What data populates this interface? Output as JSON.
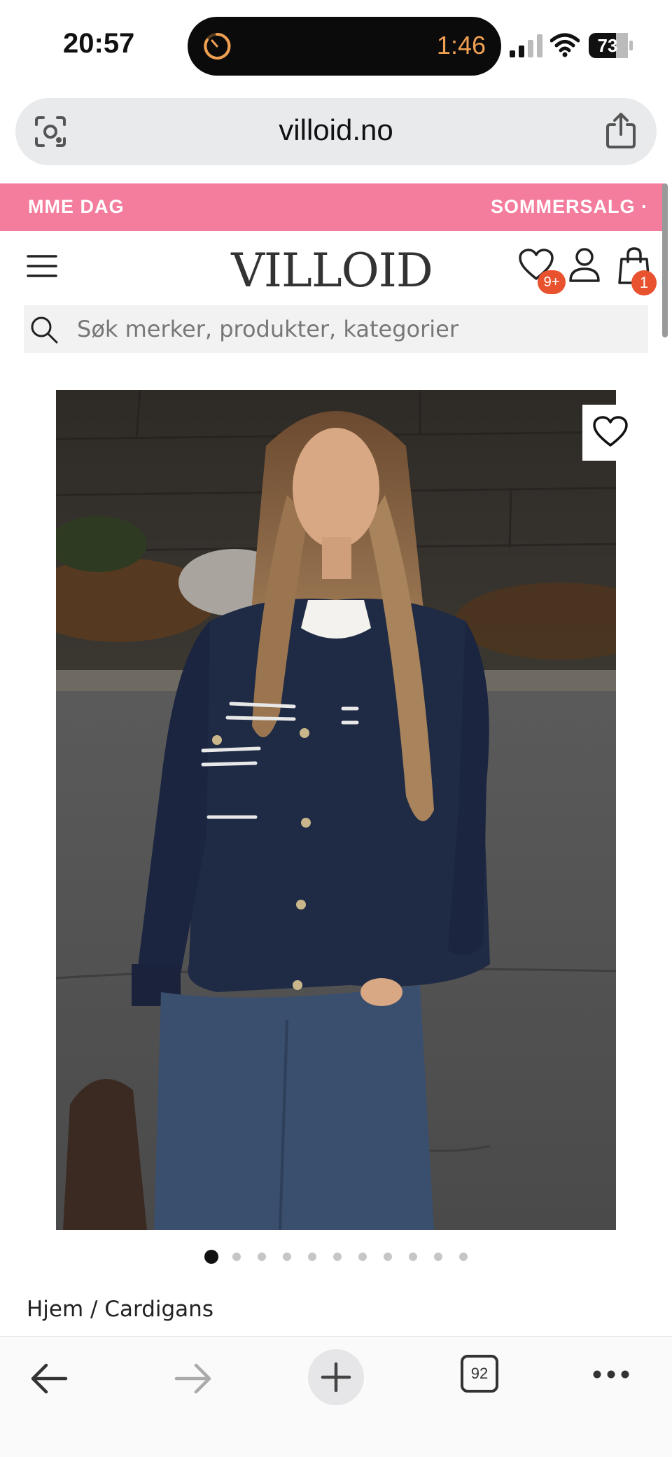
{
  "status_bar": {
    "time": "20:57",
    "timer": "1:46",
    "battery": "73"
  },
  "browser": {
    "url": "villoid.no",
    "tab_count": "92"
  },
  "promo": {
    "left_text": "MME DAG",
    "right_text": "SOMMERSALG ·"
  },
  "header": {
    "logo": "VILLOID",
    "wishlist_badge": "9+",
    "cart_badge": "1"
  },
  "search": {
    "placeholder": "Søk merker, produkter, kategorier"
  },
  "carousel": {
    "total_images": 11,
    "active_index": 0
  },
  "breadcrumb": {
    "home": "Hjem",
    "separator": " / ",
    "category": "Cardigans"
  },
  "colors": {
    "promo_bg": "#f47c9c",
    "badge": "#e8522e",
    "cardigan": "#1f2a44",
    "timer": "#f0a052"
  }
}
